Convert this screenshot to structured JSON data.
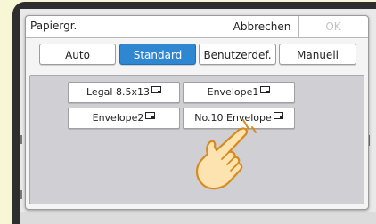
{
  "dialog": {
    "title": "Papiergr.",
    "cancel_label": "Abbrechen",
    "ok_label": "OK",
    "ok_enabled": false
  },
  "tabs": [
    {
      "label": "Auto",
      "selected": false
    },
    {
      "label": "Standard",
      "selected": true
    },
    {
      "label": "Benutzerdef.",
      "selected": false
    },
    {
      "label": "Manuell",
      "selected": false
    }
  ],
  "paper_sizes": [
    {
      "label": "Legal 8.5x13",
      "icon": "landscape-orientation-icon"
    },
    {
      "label": "Envelope1",
      "icon": "landscape-orientation-icon"
    },
    {
      "label": "Envelope2",
      "icon": "landscape-orientation-icon"
    },
    {
      "label": "No.10 Envelope",
      "icon": "landscape-orientation-icon"
    }
  ],
  "hint": {
    "icon": "tapping-hand-icon"
  },
  "colors": {
    "accent": "#2f87d1",
    "background": "#f7f7d6",
    "bezel": "#2e2e2e",
    "panel": "#cfcfd4",
    "hand_fill": "#fde3b0",
    "hand_outline": "#d98a1c"
  }
}
